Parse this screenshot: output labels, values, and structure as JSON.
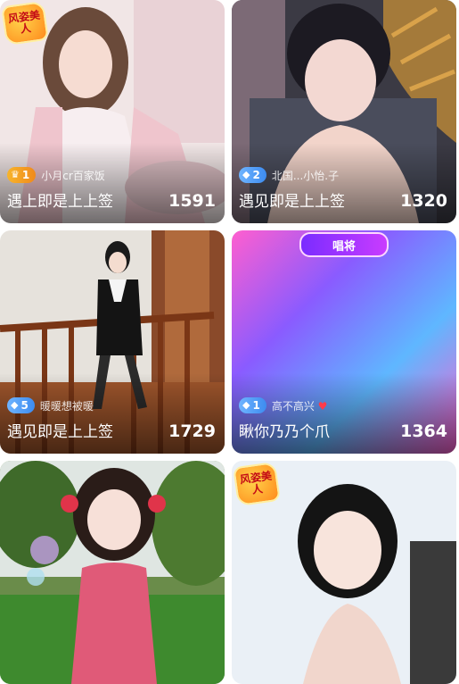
{
  "cards": [
    {
      "badge_type": "crown",
      "badge_icon": "crown-icon",
      "badge_glyph": "♛",
      "badge_level": "1",
      "host_name": "小月cr百家饭",
      "title": "遇上即是上上签",
      "viewers": "1591",
      "overlay_tag": "风姿美人"
    },
    {
      "badge_type": "diamond",
      "badge_icon": "diamond-icon",
      "badge_glyph": "◆",
      "badge_level": "2",
      "host_name": "北国...小怡.子",
      "title": "遇见即是上上签",
      "viewers": "1320"
    },
    {
      "badge_type": "diamond",
      "badge_icon": "diamond-icon",
      "badge_glyph": "◆",
      "badge_level": "5",
      "host_name": "暖暖想被暖",
      "title": "遇见即是上上签",
      "viewers": "1729"
    },
    {
      "badge_type": "diamond",
      "badge_icon": "diamond-icon",
      "badge_glyph": "◆",
      "badge_level": "1",
      "host_name": "高不高兴",
      "heart": "♥",
      "title": "瞅你乃乃个爪",
      "viewers": "1364",
      "sing_tag": "唱将"
    },
    {
      "title": "",
      "viewers": ""
    },
    {
      "overlay_tag": "风姿美人"
    }
  ],
  "colors": {
    "crown_badge": "#f7b42c",
    "diamond_badge": "#3d8cf0",
    "sing_frame": "#c93cff"
  }
}
